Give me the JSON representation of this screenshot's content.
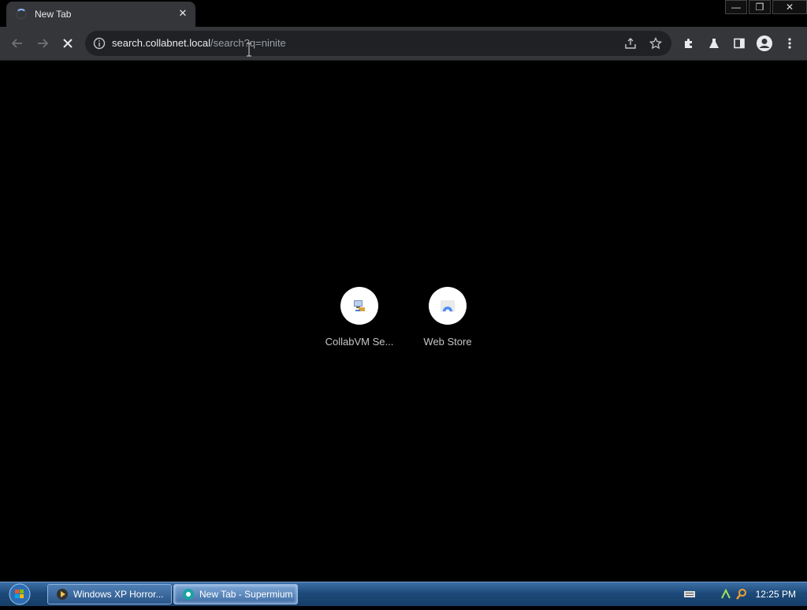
{
  "browser": {
    "tab": {
      "title": "New Tab",
      "close_glyph": "✕"
    },
    "window_controls": {
      "minimize": "—",
      "restore": "❐",
      "close": "✕"
    },
    "omnibox": {
      "host": "search.collabnet.local",
      "path": "/search?q=ninite"
    }
  },
  "shortcuts": [
    {
      "label": "CollabVM Se...",
      "icon": "collabvm-icon"
    },
    {
      "label": "Web Store",
      "icon": "web-store-icon"
    }
  ],
  "taskbar": {
    "tasks": [
      {
        "label": "Windows XP Horror...",
        "icon": "media-player-icon",
        "active": false
      },
      {
        "label": "New Tab - Supermium",
        "icon": "supermium-icon",
        "active": true
      }
    ],
    "clock": "12:25 PM"
  },
  "colors": {
    "page_bg": "#000000",
    "toolbar_bg": "#35363a",
    "omnibox_bg": "#202124",
    "taskbar_blue": "#1d4a7a"
  }
}
